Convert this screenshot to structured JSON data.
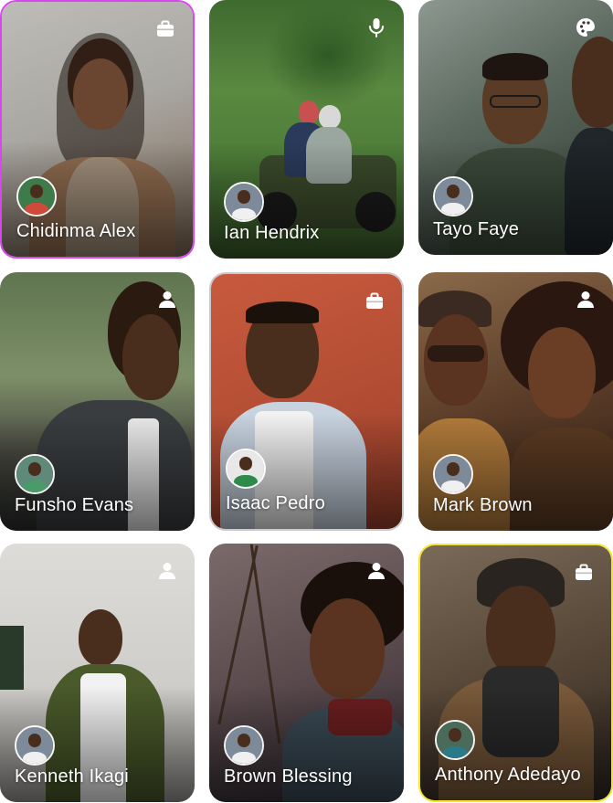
{
  "cards": [
    {
      "name": "Chidinma Alex",
      "icon": "briefcase-icon",
      "bg1": "#b9b7b3",
      "bg2": "#6f5c4b",
      "skin": "#5a3a26",
      "shirt": "#8b6a4e",
      "avatar_bg": "#3f7a4a",
      "avatar_shirt": "#cf4a3a",
      "highlight": "#d946ef"
    },
    {
      "name": "Ian Hendrix",
      "icon": "microphone-icon",
      "bg1": "#4f7a3a",
      "bg2": "#3d5b2c",
      "skin": "#6b4a32",
      "shirt": "#9aa6a0",
      "avatar_bg": "#7d8a9a",
      "avatar_shirt": "#f0f0f0"
    },
    {
      "name": "Tayo Faye",
      "icon": "palette-icon",
      "bg1": "#6f7c72",
      "bg2": "#2f3a30",
      "skin": "#5a3b26",
      "shirt": "#3b4a3a",
      "avatar_bg": "#7d8a9a",
      "avatar_shirt": "#f0f0f0"
    },
    {
      "name": "Funsho Evans",
      "icon": "person-icon",
      "bg1": "#6a7c56",
      "bg2": "#2a2d2c",
      "skin": "#4a2e1d",
      "shirt": "#3a3d40",
      "avatar_bg": "#5f8a7a",
      "avatar_shirt": "#4a9a6a"
    },
    {
      "name": "Isaac Pedro",
      "icon": "briefcase-icon",
      "bg1": "#c0553a",
      "bg2": "#9b3f2a",
      "skin": "#4a2e1d",
      "shirt": "#c8d3e0",
      "avatar_bg": "#e8e8e8",
      "avatar_shirt": "#2e8a4a",
      "highlight": "#c9c9c9"
    },
    {
      "name": "Mark Brown",
      "icon": "person-icon",
      "bg1": "#8a6a4a",
      "bg2": "#3a2418",
      "skin": "#5a3420",
      "shirt": "#b07a3a",
      "avatar_bg": "#7d8a9a",
      "avatar_shirt": "#f0f0f0"
    },
    {
      "name": "Kenneth Ikagi",
      "icon": "person-icon",
      "bg1": "#d6d4d0",
      "bg2": "#8d8a86",
      "skin": "#4a2e1d",
      "shirt": "#4a5a2a",
      "avatar_bg": "#7d8a9a",
      "avatar_shirt": "#f0f0f0"
    },
    {
      "name": "Brown Blessing",
      "icon": "person-icon",
      "bg1": "#6a5a5a",
      "bg2": "#3a3035",
      "skin": "#5a3420",
      "shirt": "#3a4a55",
      "avatar_bg": "#7d8a9a",
      "avatar_shirt": "#f0f0f0"
    },
    {
      "name": "Anthony Adedayo",
      "icon": "briefcase-icon",
      "bg1": "#6a5a48",
      "bg2": "#2e2620",
      "skin": "#4a2e1d",
      "shirt": "#7a5a3a",
      "avatar_bg": "#4a6a5a",
      "avatar_shirt": "#2a7a8a",
      "highlight": "#f5e52b"
    }
  ]
}
